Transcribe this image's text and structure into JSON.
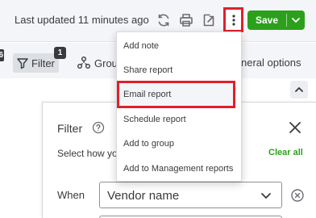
{
  "header": {
    "last_updated": "Last updated 11 minutes ago",
    "save_label": "Save"
  },
  "toolbar": {
    "edge_badge": "6",
    "filter_label": "Filter",
    "filter_count": "1",
    "group_label": "Grou",
    "general_options_label": "neral options"
  },
  "more_menu": {
    "items": [
      "Add note",
      "Share report",
      "Email report",
      "Schedule report",
      "Add to group",
      "Add to Management reports"
    ],
    "highlighted_item": "Email report"
  },
  "filter_panel": {
    "title": "Filter",
    "select_how": "Select how yo",
    "clear_all": "Clear all",
    "when_label": "When",
    "field_value": "Vendor name"
  },
  "colors": {
    "save_green": "#2ca01c",
    "highlight_red": "#e0202b",
    "toolbar_bg": "#f4f5f8"
  },
  "icons": [
    "refresh-icon",
    "print-icon",
    "export-icon",
    "more-vertical-icon",
    "chevron-down-icon",
    "filter-icon",
    "group-icon",
    "chevron-up-icon",
    "help-icon",
    "close-icon",
    "remove-icon"
  ]
}
